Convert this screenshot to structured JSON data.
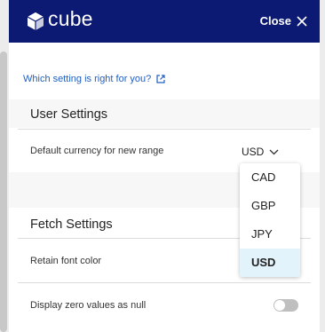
{
  "header": {
    "brand": "cube",
    "close_label": "Close"
  },
  "help_link": "Which setting is right for you?",
  "user_settings": {
    "title": "User Settings",
    "default_currency_label": "Default currency for new range",
    "selected_currency": "USD",
    "currency_options": [
      "CAD",
      "GBP",
      "JPY",
      "USD"
    ]
  },
  "fetch_settings": {
    "title": "Fetch Settings",
    "retain_font_color_label": "Retain font color",
    "zero_as_null_label": "Display zero values as null",
    "zero_as_null_enabled": false
  },
  "colors": {
    "header_bg": "#0c1a73",
    "link": "#1f5fc0",
    "selected_option_bg": "#e2f3fb"
  }
}
